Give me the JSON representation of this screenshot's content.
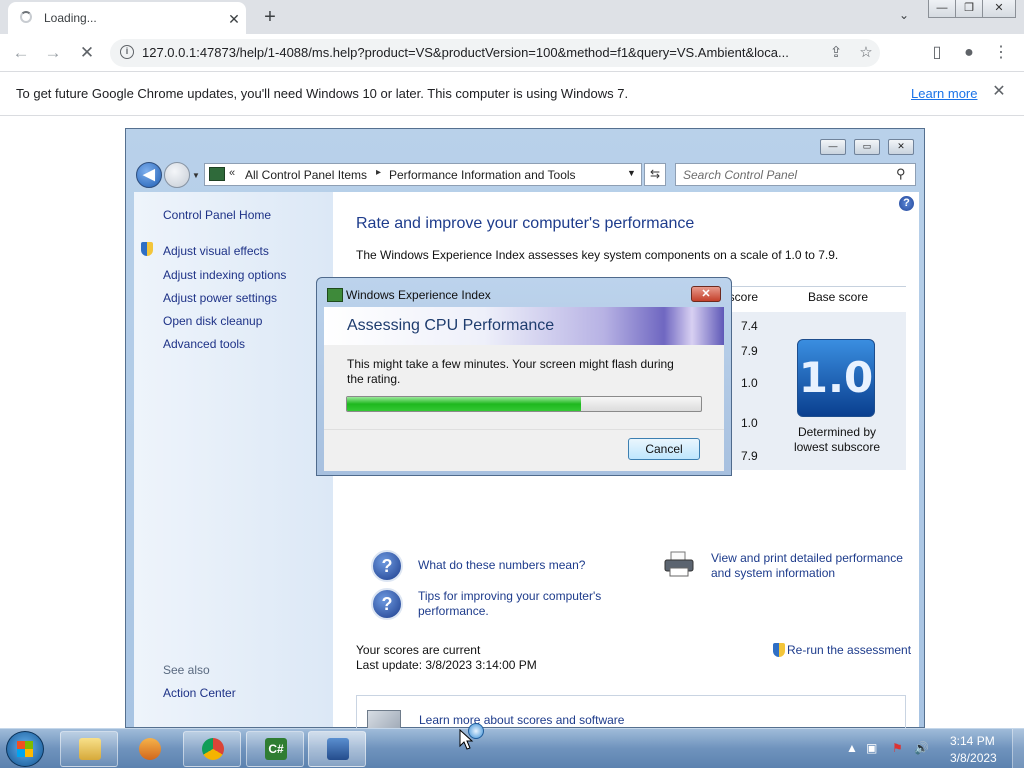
{
  "browser": {
    "tab_title": "Loading...",
    "tab_close": "✕",
    "new_tab": "+",
    "tab_dropdown": "⌄",
    "window_controls": {
      "minimize": "—",
      "maximize": "❐",
      "close": "✕"
    },
    "back": "←",
    "forward": "→",
    "stop": "✕",
    "info_icon": "i",
    "url": "127.0.0.1:47873/help/1-4088/ms.help?product=VS&productVersion=100&method=f1&query=VS.Ambient&loca...",
    "share_icon": "⇪",
    "bookmark_icon": "☆",
    "sidepanel_icon": "▯",
    "profile_icon": "●",
    "menu_icon": "⋮"
  },
  "infobar": {
    "message": "To get future Google Chrome updates, you'll need Windows 10 or later. This computer is using Windows 7.",
    "link": "Learn more",
    "close": "✕"
  },
  "control_panel": {
    "caption": {
      "minimize": "—",
      "maximize": "▭",
      "close": "✕"
    },
    "back": "◀",
    "nav_dropdown": "▼",
    "breadcrumb_chevron": "«",
    "breadcrumb_1": "All Control Panel Items",
    "breadcrumb_sep": "▸",
    "breadcrumb_2": "Performance Information and Tools",
    "breadcrumb_dropdown": "▼",
    "refresh": "⇆",
    "search_placeholder": "Search Control Panel",
    "search_icon": "⚲",
    "left": {
      "home": "Control Panel Home",
      "links": [
        "Adjust visual effects",
        "Adjust indexing options",
        "Adjust power settings",
        "Open disk cleanup",
        "Advanced tools"
      ],
      "see_also": "See also",
      "action_center": "Action Center"
    },
    "main": {
      "help": "?",
      "title": "Rate and improve your computer's performance",
      "description": "The Windows Experience Index assesses key system components on a scale of 1.0 to 7.9.",
      "col_subscore": "bscore",
      "col_base": "Base score",
      "subscores": [
        "7.4",
        "7.9",
        "1.0",
        "1.0",
        "7.9"
      ],
      "base_score": "1.0",
      "base_label": "Determined by lowest subscore",
      "q_icon": "?",
      "link_numbers": "What do these numbers mean?",
      "link_tips": "Tips for improving your computer's performance.",
      "link_print": "View and print detailed performance and system information",
      "link_learn": "Learn more about scores and software online",
      "scores_current": "Your scores are current",
      "last_update": "Last update: 3/8/2023 3:14:00 PM",
      "rerun": "Re-run the assessment"
    }
  },
  "dialog": {
    "title": "Windows Experience Index",
    "close": "✕",
    "heading": "Assessing CPU Performance",
    "message": "This might take a few minutes. Your screen might flash during the rating.",
    "progress": 0.66,
    "cancel": "Cancel"
  },
  "taskbar": {
    "csharp_label": "C#",
    "tray_arrow": "▲",
    "tray_network": "▣",
    "tray_flag": "⚑",
    "tray_volume": "🔊",
    "time": "3:14 PM",
    "date": "3/8/2023"
  }
}
